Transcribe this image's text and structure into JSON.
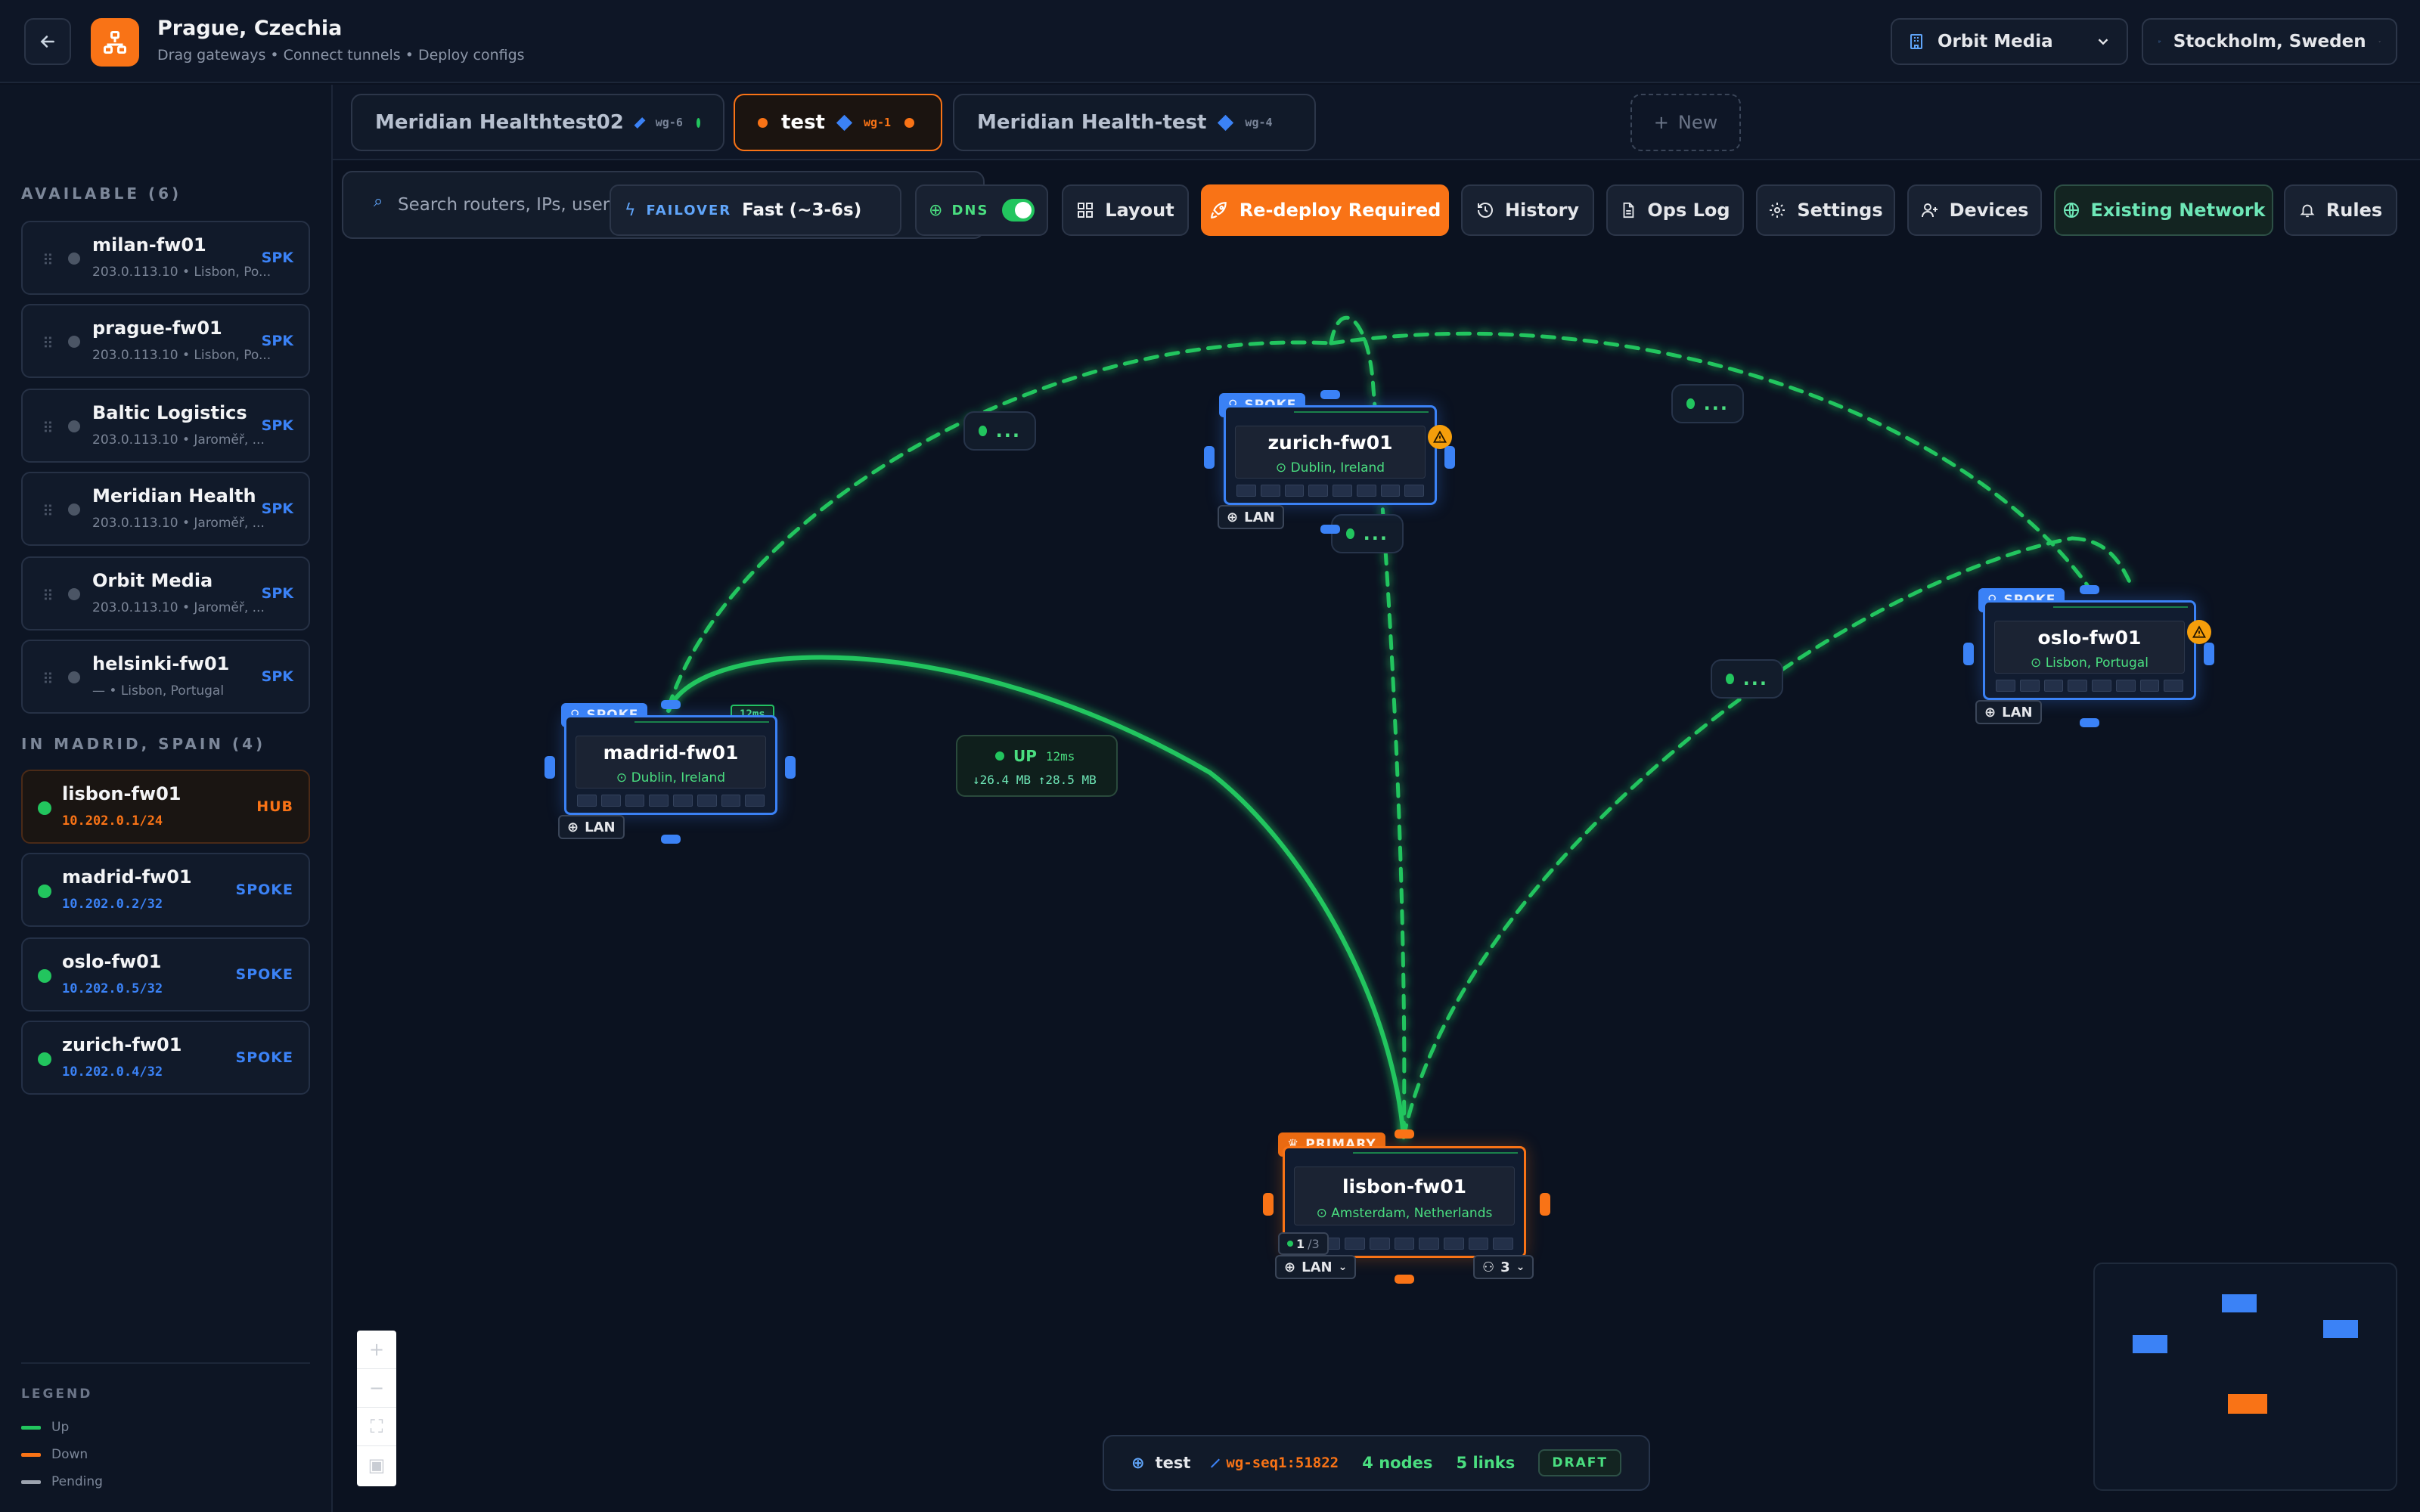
{
  "header": {
    "title": "Prague, Czechia",
    "subtitle": "Drag gateways • Connect tunnels • Deploy configs",
    "org": "Orbit Media",
    "location": "Stockholm, Sweden"
  },
  "tabs": [
    {
      "label": "Meridian Healthtest02",
      "wg": "wg-6",
      "status_color": "#22c55e",
      "active": false
    },
    {
      "label": "test",
      "wg": "wg-1",
      "status_color": "#f97316",
      "active": true
    },
    {
      "label": "Meridian Health-test",
      "wg": "wg-4",
      "status_color": "",
      "active": false
    }
  ],
  "new_tab_label": "New",
  "sidebar": {
    "available_header": "AVAILABLE (6)",
    "available": [
      {
        "name": "milan-fw01",
        "sub": "203.0.113.10 • Lisbon, Po...",
        "tag": "SPK"
      },
      {
        "name": "prague-fw01",
        "sub": "203.0.113.10 • Lisbon, Po...",
        "tag": "SPK"
      },
      {
        "name": "Baltic Logistics",
        "sub": "203.0.113.10 • Jaroměř, ...",
        "tag": "SPK"
      },
      {
        "name": "Meridian Health",
        "sub": "203.0.113.10 • Jaroměř, ...",
        "tag": "SPK"
      },
      {
        "name": "Orbit Media",
        "sub": "203.0.113.10 • Jaroměř, ...",
        "tag": "SPK"
      },
      {
        "name": "helsinki-fw01",
        "sub": "— • Lisbon, Portugal",
        "tag": "SPK"
      }
    ],
    "in_site_header": "IN MADRID, SPAIN (4)",
    "in_site": [
      {
        "name": "lisbon-fw01",
        "ip": "10.202.0.1/24",
        "tag": "HUB"
      },
      {
        "name": "madrid-fw01",
        "ip": "10.202.0.2/32",
        "tag": "SPOKE"
      },
      {
        "name": "oslo-fw01",
        "ip": "10.202.0.5/32",
        "tag": "SPOKE"
      },
      {
        "name": "zurich-fw01",
        "ip": "10.202.0.4/32",
        "tag": "SPOKE"
      }
    ],
    "legend": {
      "header": "LEGEND",
      "items": [
        {
          "label": "Up",
          "color": "#22c55e"
        },
        {
          "label": "Down",
          "color": "#f97316"
        },
        {
          "label": "Pending",
          "color": "#9ca3af"
        }
      ]
    }
  },
  "toolbar": {
    "search_placeholder": "Search routers, IPs, users, lo",
    "failover_label": "FAILOVER",
    "failover_value": "Fast (~3-6s)",
    "dns_label": "DNS",
    "dns_on": true,
    "layout": "Layout",
    "redeploy": "Re-deploy Required",
    "history": "History",
    "opslog": "Ops Log",
    "settings": "Settings",
    "devices": "Devices",
    "existing_network": "Existing Network",
    "rules": "Rules"
  },
  "nodes": {
    "zurich": {
      "badge": "SPOKE",
      "name": "zurich-fw01",
      "location": "Dublin, Ireland",
      "lan": "LAN"
    },
    "oslo": {
      "badge": "SPOKE",
      "name": "oslo-fw01",
      "location": "Lisbon, Portugal",
      "lan": "LAN"
    },
    "madrid": {
      "badge": "SPOKE",
      "name": "madrid-fw01",
      "location": "Dublin, Ireland",
      "lan": "LAN",
      "latency": "12ms"
    },
    "lisbon": {
      "badge": "PRIMARY",
      "name": "lisbon-fw01",
      "location": "Amsterdam, Netherlands",
      "lan": "LAN",
      "counter": "1",
      "counter_total": "/3",
      "users": "3"
    }
  },
  "edges": {
    "pending_label": "...",
    "up_label": "UP",
    "up_latency": "12ms",
    "up_traffic": "↓26.4 MB ↑28.5 MB"
  },
  "status_bar": {
    "network": "test",
    "wg_seq": "wg-seq1:51822",
    "nodes": "4 nodes",
    "links": "5 links",
    "state": "DRAFT"
  },
  "colors": {
    "accent": "#f97316",
    "spoke": "#3b82f6",
    "up": "#22c55e"
  }
}
